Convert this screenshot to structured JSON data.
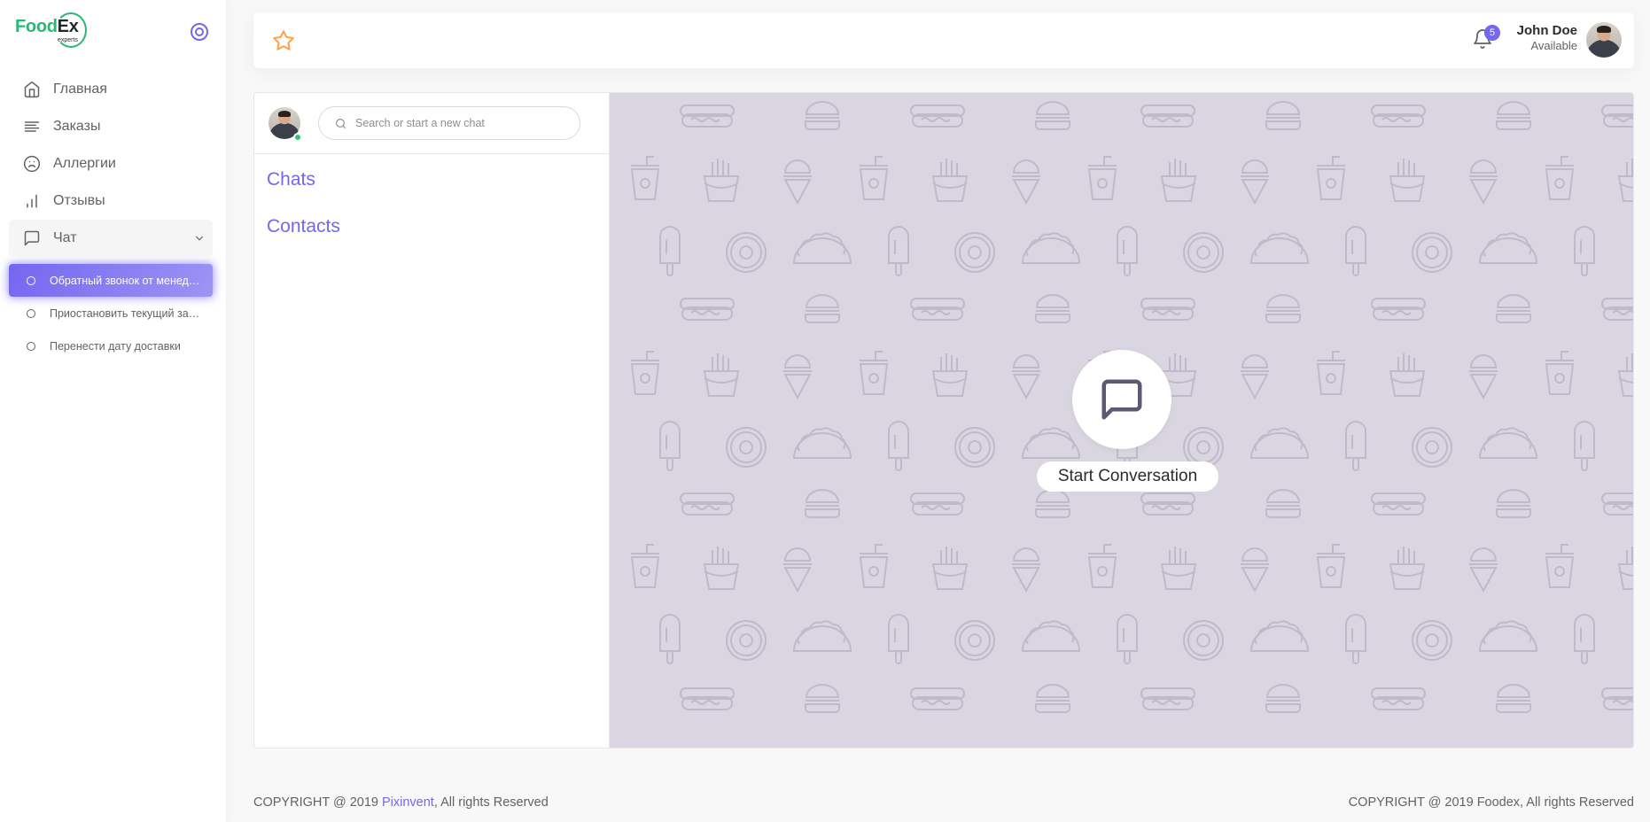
{
  "brand": {
    "name_part1": "Food",
    "name_part2": "Ex",
    "tagline": "experts"
  },
  "colors": {
    "primary": "#7367f0",
    "brand_green": "#2bb673",
    "online": "#28c76f",
    "star": "#ff9f43",
    "chat_bg": "#d9d6e2"
  },
  "sidebar": {
    "items": [
      {
        "label": "Главная",
        "icon": "home-icon"
      },
      {
        "label": "Заказы",
        "icon": "list-icon"
      },
      {
        "label": "Аллергии",
        "icon": "frown-icon"
      },
      {
        "label": "Отзывы",
        "icon": "bar-chart-icon"
      },
      {
        "label": "Чат",
        "icon": "message-square-icon"
      }
    ],
    "chat_subitems": [
      {
        "label": "Обратный звонок от менеджера",
        "active": true
      },
      {
        "label": "Приостановить текущий заказ",
        "active": false
      },
      {
        "label": "Перенести дату доставки",
        "active": false
      }
    ]
  },
  "navbar": {
    "notification_count": "5",
    "user_name": "John Doe",
    "user_status": "Available"
  },
  "chat": {
    "search_placeholder": "Search or start a new chat",
    "chats_title": "Chats",
    "contacts_title": "Contacts",
    "start_label": "Start Conversation"
  },
  "footer": {
    "left_prefix": "COPYRIGHT @ 2019 ",
    "left_link": "Pixinvent",
    "left_suffix": ", All rights Reserved",
    "right": "COPYRIGHT @ 2019 Foodex, All rights Reserved"
  }
}
